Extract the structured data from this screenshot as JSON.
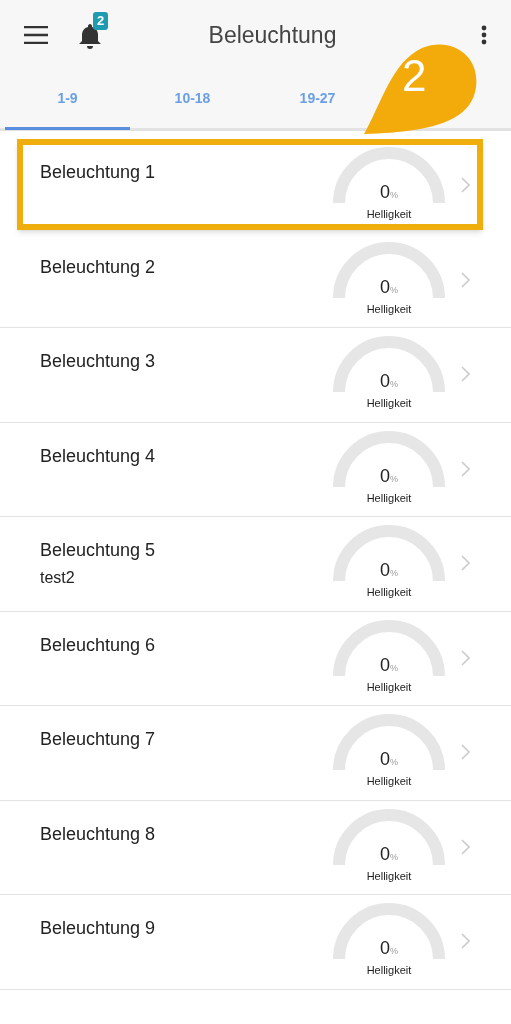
{
  "app_bar": {
    "title": "Beleuchtung",
    "notification_count": "2"
  },
  "tabs": [
    {
      "label": "1-9",
      "selected": true
    },
    {
      "label": "10-18",
      "selected": false
    },
    {
      "label": "19-27",
      "selected": false
    }
  ],
  "callout": {
    "label": "2"
  },
  "lights": [
    {
      "name": "Beleuchtung 1",
      "highlighted": true,
      "value": "0",
      "unit": "%",
      "caption": "Helligkeit"
    },
    {
      "name": "Beleuchtung 2",
      "highlighted": false,
      "value": "0",
      "unit": "%",
      "caption": "Helligkeit"
    },
    {
      "name": "Beleuchtung 3",
      "highlighted": false,
      "value": "0",
      "unit": "%",
      "caption": "Helligkeit"
    },
    {
      "name": "Beleuchtung 4",
      "highlighted": false,
      "value": "0",
      "unit": "%",
      "caption": "Helligkeit"
    },
    {
      "name": "Beleuchtung 5",
      "subtitle": "test2",
      "highlighted": false,
      "value": "0",
      "unit": "%",
      "caption": "Helligkeit"
    },
    {
      "name": "Beleuchtung 6",
      "highlighted": false,
      "value": "0",
      "unit": "%",
      "caption": "Helligkeit"
    },
    {
      "name": "Beleuchtung 7",
      "highlighted": false,
      "value": "0",
      "unit": "%",
      "caption": "Helligkeit"
    },
    {
      "name": "Beleuchtung 8",
      "highlighted": false,
      "value": "0",
      "unit": "%",
      "caption": "Helligkeit"
    },
    {
      "name": "Beleuchtung 9",
      "highlighted": false,
      "value": "0",
      "unit": "%",
      "caption": "Helligkeit"
    }
  ]
}
